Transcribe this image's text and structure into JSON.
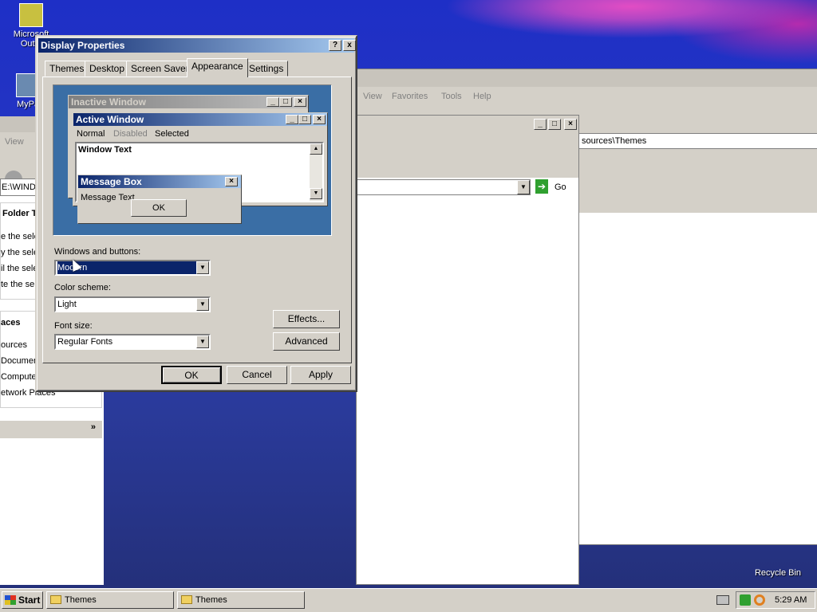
{
  "desktop": {
    "icons": [
      {
        "label": "Microsoft Outlook",
        "short": "Microsoft Outlo"
      },
      {
        "label": "MyPa",
        "short": "MyPa"
      },
      {
        "label": "Recycle Bin",
        "short": "Recycle Bin"
      }
    ]
  },
  "explorer_back": {
    "menu": [
      "View",
      "Favorites",
      "Tools",
      "Help"
    ],
    "address": "sources\\Themes",
    "go_label": "Go"
  },
  "explorer_left": {
    "menu_view": "View",
    "address": "E:\\WIND",
    "folder_tasks_header": "Folder T",
    "tasks": [
      "e the sele",
      "y the sele",
      "il the sele",
      "te the sel"
    ],
    "places_header": "aces",
    "places": [
      "ources",
      "Document",
      "Computer",
      "etwork Places"
    ]
  },
  "dialog": {
    "title": "Display Properties",
    "tabs": [
      "Themes",
      "Desktop",
      "Screen Saver",
      "Appearance",
      "Settings"
    ],
    "active_tab": "Appearance",
    "preview": {
      "inactive_title": "Inactive Window",
      "active_title": "Active Window",
      "menu": [
        "Normal",
        "Disabled",
        "Selected"
      ],
      "window_text": "Window Text",
      "msgbox_title": "Message Box",
      "msgbox_text": "Message Text",
      "ok": "OK"
    },
    "windows_buttons_label": "Windows and buttons:",
    "windows_buttons_value": "Modern",
    "color_scheme_label": "Color scheme:",
    "color_scheme_value": "Light",
    "font_size_label": "Font size:",
    "font_size_value": "Regular Fonts",
    "effects_btn": "Effects...",
    "advanced_btn": "Advanced",
    "ok_btn": "OK",
    "cancel_btn": "Cancel",
    "apply_btn": "Apply",
    "help_icon": "?",
    "close_icon": "x"
  },
  "taskbar": {
    "start": "Start",
    "tasks": [
      "Themes",
      "Themes"
    ],
    "clock": "5:29 AM"
  },
  "colors": {
    "title_active": "#0a246a",
    "title_gradient_end": "#a6caf0",
    "face": "#d4d0c8",
    "preview_bg": "#3a6ea5",
    "selection": "#0a246a"
  }
}
